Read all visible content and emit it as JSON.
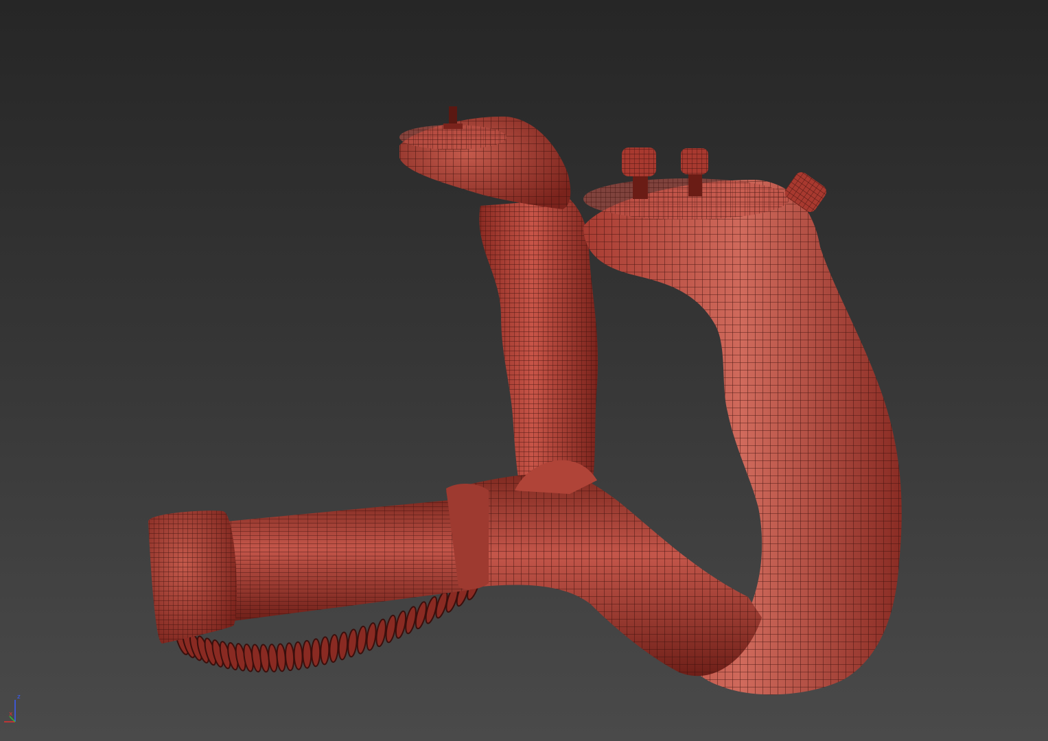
{
  "viewport": {
    "background_top": "#262626",
    "background_bottom": "#4a4a4a",
    "model": {
      "shading": "red-wireframe-on-shaded",
      "surface_color": "#b8453a",
      "surface_shadow": "#7a231c",
      "surface_highlight": "#d8685c",
      "wire_color": "#3a0f0c"
    },
    "axis_gizmo": {
      "z_label": "z",
      "x_label": "x",
      "z_color": "#3a5cff",
      "x_color": "#e03030",
      "y_color": "#30c030"
    }
  }
}
